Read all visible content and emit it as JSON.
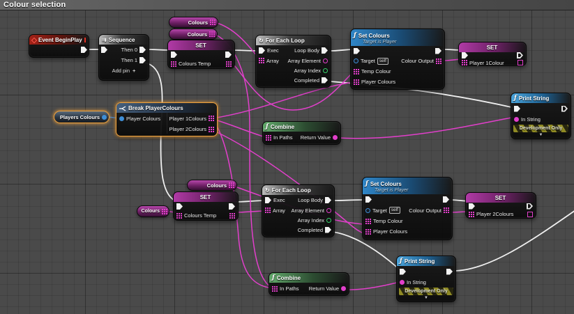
{
  "titlebar": {
    "title": "Colour selection"
  },
  "colors": {
    "exec_wire": "#f0f0f0",
    "data_wire": "#e23fcb",
    "struct_wire": "#3f86d2",
    "selection_outline": "#f0a23c"
  },
  "nodes": {
    "event_begin_play": {
      "title": "Event BeginPlay"
    },
    "sequence": {
      "title": "Sequence",
      "then0": "Then 0",
      "then1": "Then 1",
      "add_pin": "Add pin",
      "plus": "+"
    },
    "pill_colours_1": {
      "label": "Colours"
    },
    "pill_colours_2": {
      "label": "Colours"
    },
    "set_top": {
      "title": "SET",
      "var": "Colours Temp"
    },
    "foreach_top": {
      "title": "For Each Loop",
      "exec": "Exec",
      "array": "Array",
      "loop_body": "Loop Body",
      "array_element": "Array Element",
      "array_index": "Array Index",
      "completed": "Completed"
    },
    "set_colours_top": {
      "title": "Set Colours",
      "subtitle": "Target is Player",
      "target": "Target",
      "self": "self",
      "temp_colour": "Temp Colour",
      "player_colours": "Player Colours",
      "colour_output": "Colour Output"
    },
    "set_player1": {
      "title": "SET",
      "var": "Player 1Colour"
    },
    "print_string_top": {
      "title": "Print String",
      "in_string": "In String",
      "dev_only": "Development Only",
      "expander": "▼"
    },
    "pill_players_colours": {
      "label": "Players Colours"
    },
    "break_playercolours": {
      "title": "Break PlayerColours",
      "in": "Player Colours",
      "out1": "Player 1Colours",
      "out2": "Player 2Colours"
    },
    "combine_mid": {
      "title": "Combine",
      "in_paths": "In Paths",
      "return_value": "Return Value"
    },
    "pill_colours_3": {
      "label": "Colours"
    },
    "pill_colours_4": {
      "label": "Colours"
    },
    "set_bottom": {
      "title": "SET",
      "var": "Colours Temp"
    },
    "foreach_bottom": {
      "title": "For Each Loop",
      "exec": "Exec",
      "array": "Array",
      "loop_body": "Loop Body",
      "array_element": "Array Element",
      "array_index": "Array Index",
      "completed": "Completed"
    },
    "set_colours_bottom": {
      "title": "Set Colours",
      "subtitle": "Target is Player",
      "target": "Target",
      "self": "self",
      "temp_colour": "Temp Colour",
      "player_colours": "Player Colours",
      "colour_output": "Colour Output"
    },
    "set_player2": {
      "title": "SET",
      "var": "Player 2Colours"
    },
    "print_string_bottom": {
      "title": "Print String",
      "in_string": "In String",
      "dev_only": "Development Only",
      "expander": "▼"
    },
    "combine_bottom": {
      "title": "Combine",
      "in_paths": "In Paths",
      "return_value": "Return Value"
    }
  }
}
